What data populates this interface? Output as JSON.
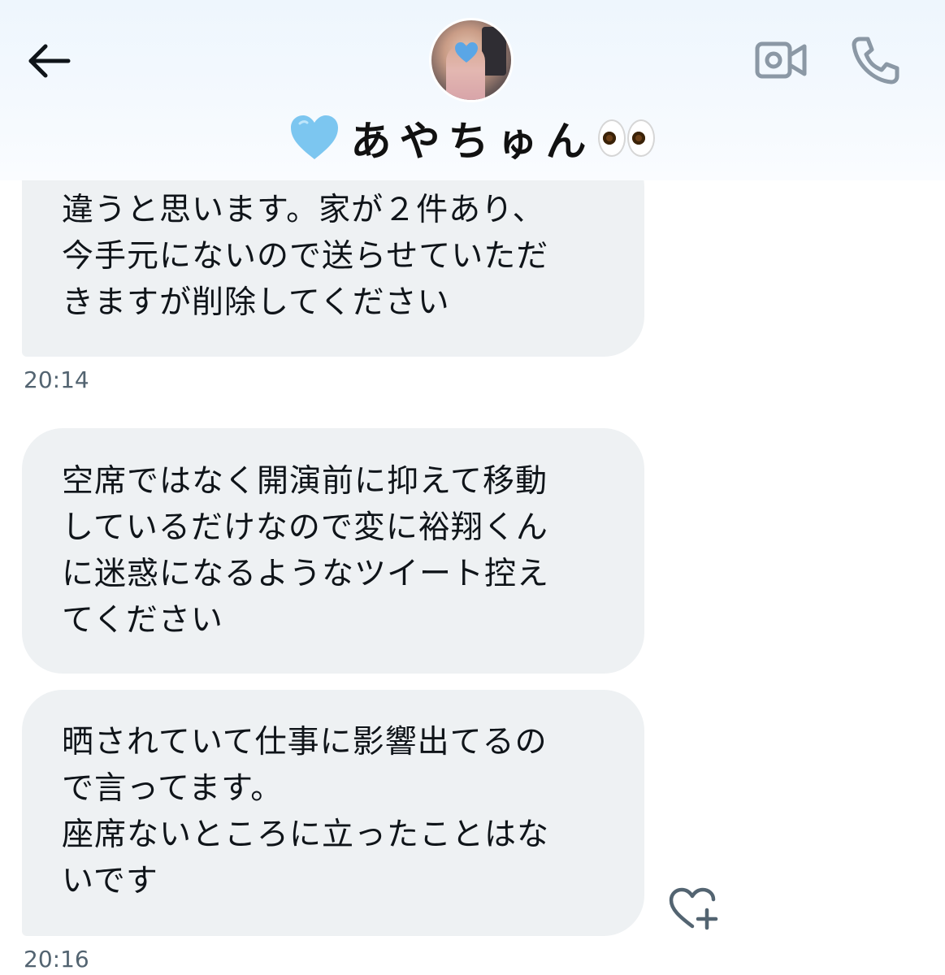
{
  "header": {
    "contact_name": "あやちゅん",
    "icons": {
      "back": "back-arrow-icon",
      "video": "video-camera-icon",
      "phone": "phone-icon",
      "heart_emoji": "light-blue-heart-emoji",
      "eyes_emoji": "eyes-emoji",
      "avatar_heart": "blue-heart-sticker"
    }
  },
  "messages": [
    {
      "lines": [
        "違うと思います。家が２件あり、",
        "今手元にないので送らせていただ",
        "きますが削除してください"
      ],
      "time": "20:14"
    },
    {
      "lines": [
        "空席ではなく開演前に抑えて移動",
        "しているだけなので変に裕翔くん",
        "に迷惑になるようなツイート控え",
        "てください"
      ]
    },
    {
      "lines": [
        "晒されていて仕事に影響出てるの",
        "で言ってます。",
        "座席ないところに立ったことはな",
        "いです"
      ],
      "time": "20:16"
    }
  ],
  "actions": {
    "react_icon": "heart-plus-icon"
  },
  "colors": {
    "bubble_bg": "#eef1f3",
    "text": "#0f1419",
    "timestamp": "#536471",
    "icon_gray": "#536471",
    "heart_blue": "#7cc6f0"
  }
}
